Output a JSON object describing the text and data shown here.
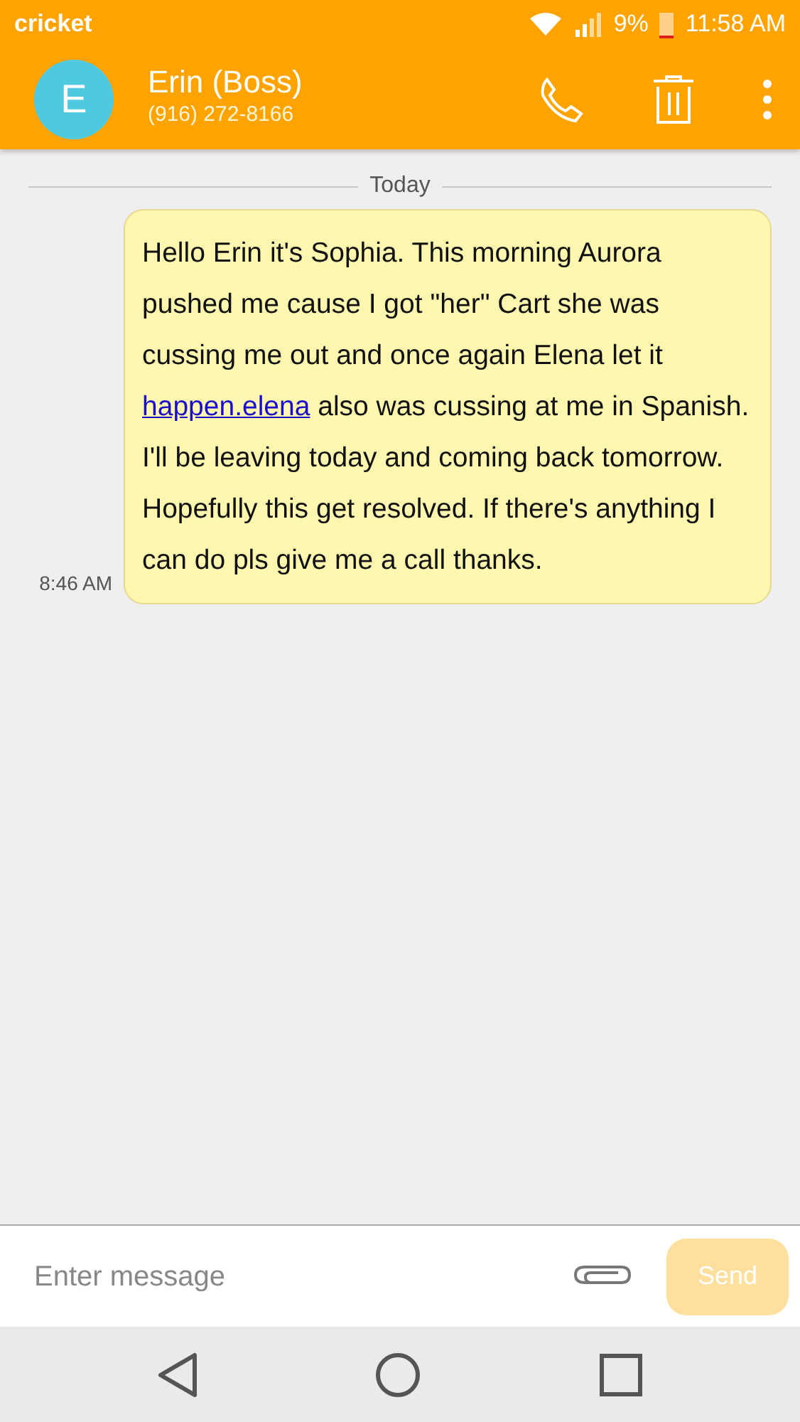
{
  "status_bar": {
    "carrier": "cricket",
    "battery": "9%",
    "time": "11:58 AM"
  },
  "header": {
    "avatar_letter": "E",
    "name": "Erin (Boss)",
    "phone": "(916) 272-8166"
  },
  "conversation": {
    "date_divider": "Today",
    "messages": [
      {
        "time": "8:46 AM",
        "parts": [
          {
            "kind": "text",
            "text": "Hello Erin it's Sophia. This morning Aurora pushed me cause I got \"her\" Cart she was cussing me out and once again Elena let it "
          },
          {
            "kind": "link",
            "text": "happen.elena"
          },
          {
            "kind": "text",
            "text": " also was cussing at me in Spanish. I'll be leaving today and coming back tomorrow. Hopefully this get resolved. If there's anything I can do pls give me a call thanks."
          }
        ]
      }
    ]
  },
  "composer": {
    "placeholder": "Enter message",
    "send": {
      "label": "Send",
      "disabled": true
    }
  }
}
